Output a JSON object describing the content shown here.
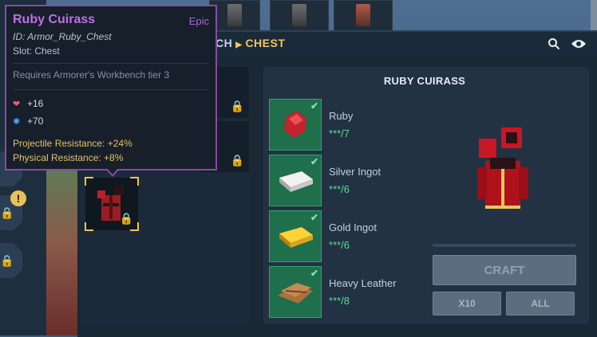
{
  "tooltip": {
    "name": "Ruby Cuirass",
    "rarity": "Epic",
    "id_line": "ID: Armor_Ruby_Chest",
    "slot_line": "Slot: Chest",
    "requirement": "Requires Armorer's Workbench tier 3",
    "stats": [
      {
        "icon": "heart-icon",
        "value": "+16"
      },
      {
        "icon": "mana-icon",
        "value": "+70"
      }
    ],
    "resistances": [
      "Projectile Resistance: +24%",
      "Physical Resistance: +8%"
    ]
  },
  "breadcrumb": {
    "partial": "CH",
    "current": "CHEST"
  },
  "recipe": {
    "title": "RUBY CUIRASS",
    "ingredients": [
      {
        "name": "Ruby",
        "count": "***/7",
        "icon": "ruby-icon"
      },
      {
        "name": "Silver Ingot",
        "count": "***/6",
        "icon": "silver-ingot-icon"
      },
      {
        "name": "Gold Ingot",
        "count": "***/6",
        "icon": "gold-ingot-icon"
      },
      {
        "name": "Heavy Leather",
        "count": "***/8",
        "icon": "leather-icon"
      }
    ],
    "craft_label": "CRAFT",
    "x10_label": "X10",
    "all_label": "ALL"
  },
  "colors": {
    "accent": "#f3c75a",
    "epic": "#c06fe6",
    "ready": "#5fdc8e"
  }
}
